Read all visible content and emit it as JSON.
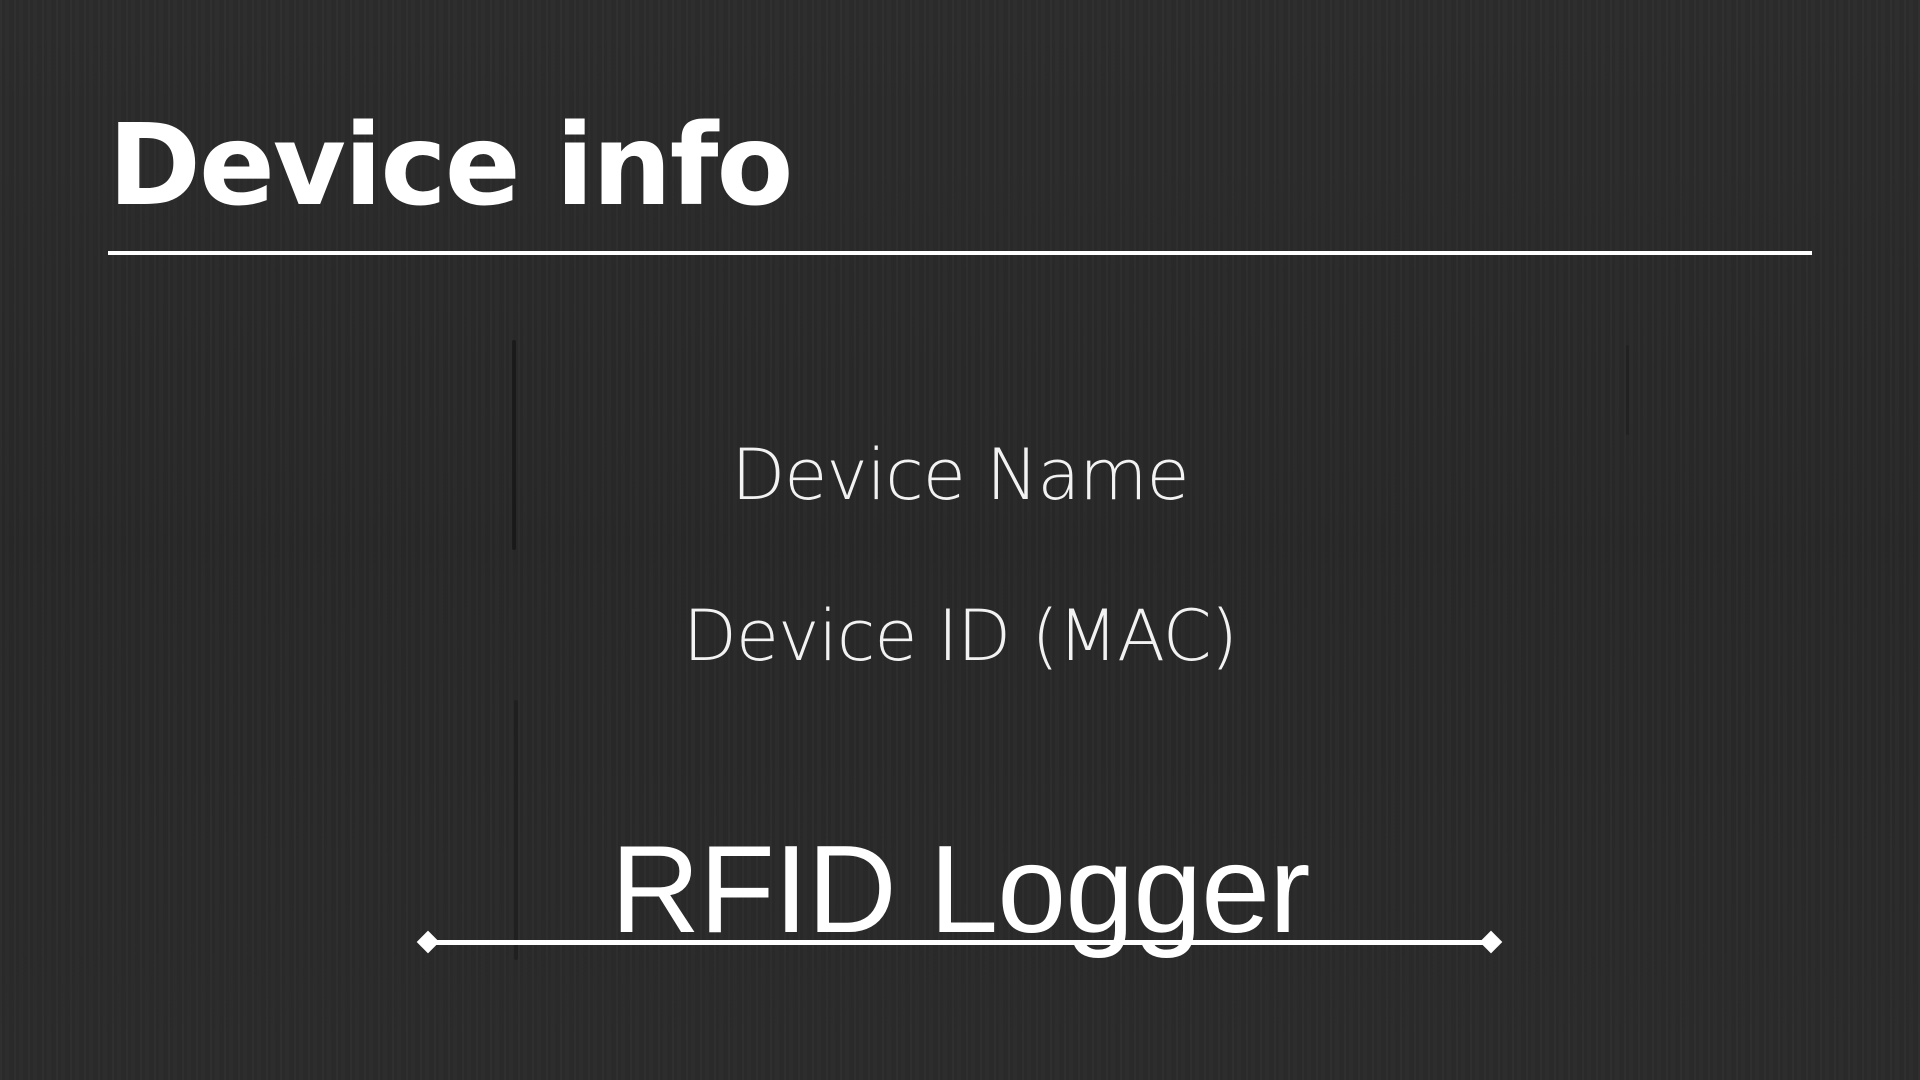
{
  "header": {
    "title": "Device info"
  },
  "fields": {
    "device_name_label": "Device Name",
    "device_id_label": "Device ID (MAC)"
  },
  "logo": {
    "text": "RFID Logger"
  },
  "colors": {
    "background": "#2a2a2a",
    "text": "#ffffff"
  }
}
